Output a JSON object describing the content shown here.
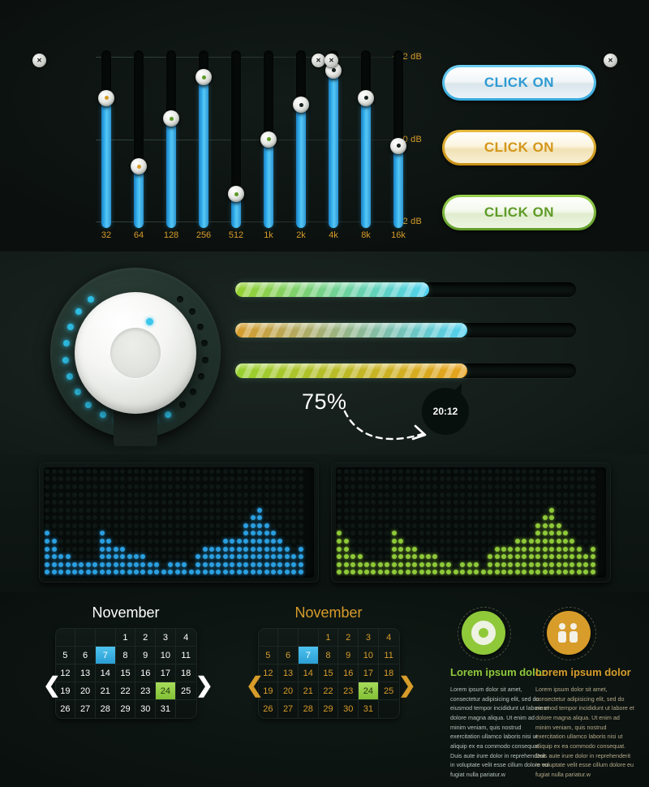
{
  "equalizer": {
    "name": "graphic-equalizer",
    "scale_labels": [
      "+12 dB",
      "0 dB",
      "-12 dB"
    ],
    "bands": [
      {
        "freq": "32",
        "value_db": 6,
        "dot_color": "#d79c2a"
      },
      {
        "freq": "64",
        "value_db": -4,
        "dot_color": "#d79c2a"
      },
      {
        "freq": "128",
        "value_db": 3,
        "dot_color": "#5e9b27"
      },
      {
        "freq": "256",
        "value_db": 9,
        "dot_color": "#5e9b27"
      },
      {
        "freq": "512",
        "value_db": -8,
        "dot_color": "#5e9b27"
      },
      {
        "freq": "1k",
        "value_db": 0,
        "dot_color": "#5e9b27"
      },
      {
        "freq": "2k",
        "value_db": 5,
        "dot_color": "#16201d"
      },
      {
        "freq": "4k",
        "value_db": 10,
        "dot_color": "#16201d"
      },
      {
        "freq": "8k",
        "value_db": 6,
        "dot_color": "#16201d"
      },
      {
        "freq": "16k",
        "value_db": -1,
        "dot_color": "#16201d"
      }
    ]
  },
  "buttons": [
    {
      "label": "CLICK ON",
      "accent": "#35a8dc",
      "text_color": "#2e9ad2"
    },
    {
      "label": "CLICK ON",
      "accent": "#c78f16",
      "text_color": "#d3961a"
    },
    {
      "label": "CLICK ON",
      "accent": "#5f9b28",
      "text_color": "#5e9b27"
    }
  ],
  "knob": {
    "name": "rotary-volume-knob",
    "total_dots": 21,
    "active_dots": 13,
    "active_color": "#2fc1e8",
    "inactive_color": "#0b1412"
  },
  "progress_bars": [
    {
      "name": "progress-bar-1",
      "percent": 57,
      "from": "#96d130",
      "to": "#4fd2f2"
    },
    {
      "name": "progress-bar-2",
      "percent": 68,
      "from": "#d79c2a",
      "to": "#4fd2f2"
    },
    {
      "name": "progress-bar-3",
      "percent": 68,
      "from": "#96d130",
      "to": "#e8a11c"
    }
  ],
  "callout": {
    "percent_label": "75%",
    "badge_time": "20:12"
  },
  "led_panels": [
    {
      "name": "spectrum-analyzer-blue",
      "color": "#2b9fe0",
      "dim_color": "#16231f",
      "cols": 38,
      "rows": 14,
      "levels": [
        6,
        5,
        3,
        3,
        2,
        2,
        2,
        2,
        6,
        5,
        4,
        4,
        3,
        3,
        3,
        2,
        2,
        1,
        2,
        2,
        2,
        1,
        3,
        4,
        4,
        4,
        5,
        5,
        5,
        7,
        8,
        9,
        7,
        6,
        5,
        4,
        3,
        4
      ]
    },
    {
      "name": "spectrum-analyzer-green",
      "color": "#8fc93a",
      "dim_color": "#16231f",
      "cols": 38,
      "rows": 14,
      "levels": [
        6,
        5,
        3,
        3,
        2,
        2,
        2,
        2,
        6,
        5,
        4,
        4,
        3,
        3,
        3,
        2,
        2,
        1,
        2,
        2,
        2,
        1,
        3,
        4,
        4,
        4,
        5,
        5,
        5,
        7,
        8,
        9,
        7,
        6,
        5,
        4,
        3,
        4
      ]
    }
  ],
  "calendars": [
    {
      "name": "calendar-white",
      "month": "November",
      "theme": "white",
      "prev_label": "❮",
      "next_label": "❯",
      "leading_blanks": 3,
      "days": [
        1,
        2,
        3,
        4,
        5,
        6,
        7,
        8,
        9,
        10,
        11,
        12,
        13,
        14,
        15,
        16,
        17,
        18,
        19,
        20,
        21,
        22,
        23,
        24,
        25,
        26,
        27,
        28,
        29,
        30,
        31
      ],
      "highlight_blue": 7,
      "highlight_green": 24
    },
    {
      "name": "calendar-amber",
      "month": "November",
      "theme": "amber",
      "prev_label": "❮",
      "next_label": "❯",
      "leading_blanks": 3,
      "days": [
        1,
        2,
        3,
        4,
        5,
        6,
        7,
        8,
        9,
        10,
        11,
        12,
        13,
        14,
        15,
        16,
        17,
        18,
        19,
        20,
        21,
        22,
        23,
        24,
        25,
        26,
        27,
        28,
        29,
        30,
        31
      ],
      "highlight_blue": 7,
      "highlight_green": 24
    }
  ],
  "features": [
    {
      "name": "feature-media",
      "icon": "disc-icon",
      "icon_color": "#8fc93a",
      "heading": "Lorem ipsum dolor",
      "heading_color": "#8fc93a",
      "body": "Lorem ipsum dolor sit amet, consectetur adipisicing elit, sed do eiusmod tempor incididunt ut labore et dolore magna aliqua. Ut enim ad minim veniam, quis nostrud exercitation ullamco laboris nisi ut aliquip ex ea commodo consequat. Duis aute irure dolor in reprehenderit in voluptate velit esse cillum dolore eu fugiat nulla pariatur.w"
    },
    {
      "name": "feature-users",
      "icon": "people-icon",
      "icon_color": "#d79c2a",
      "heading": "Lorem ipsum dolor",
      "heading_color": "#d79c2a",
      "body": "Lorem ipsum dolor sit amet, consectetur adipisicing elit, sed do eiusmod tempor incididunt ut labore et dolore magna aliqua. Ut enim ad minim veniam, quis nostrud exercitation ullamco laboris nisi ut aliquip ex ea commodo consequat. Duis aute irure dolor in reprehenderit in voluptate velit esse cillum dolore eu fugiat nulla pariatur.w"
    }
  ]
}
